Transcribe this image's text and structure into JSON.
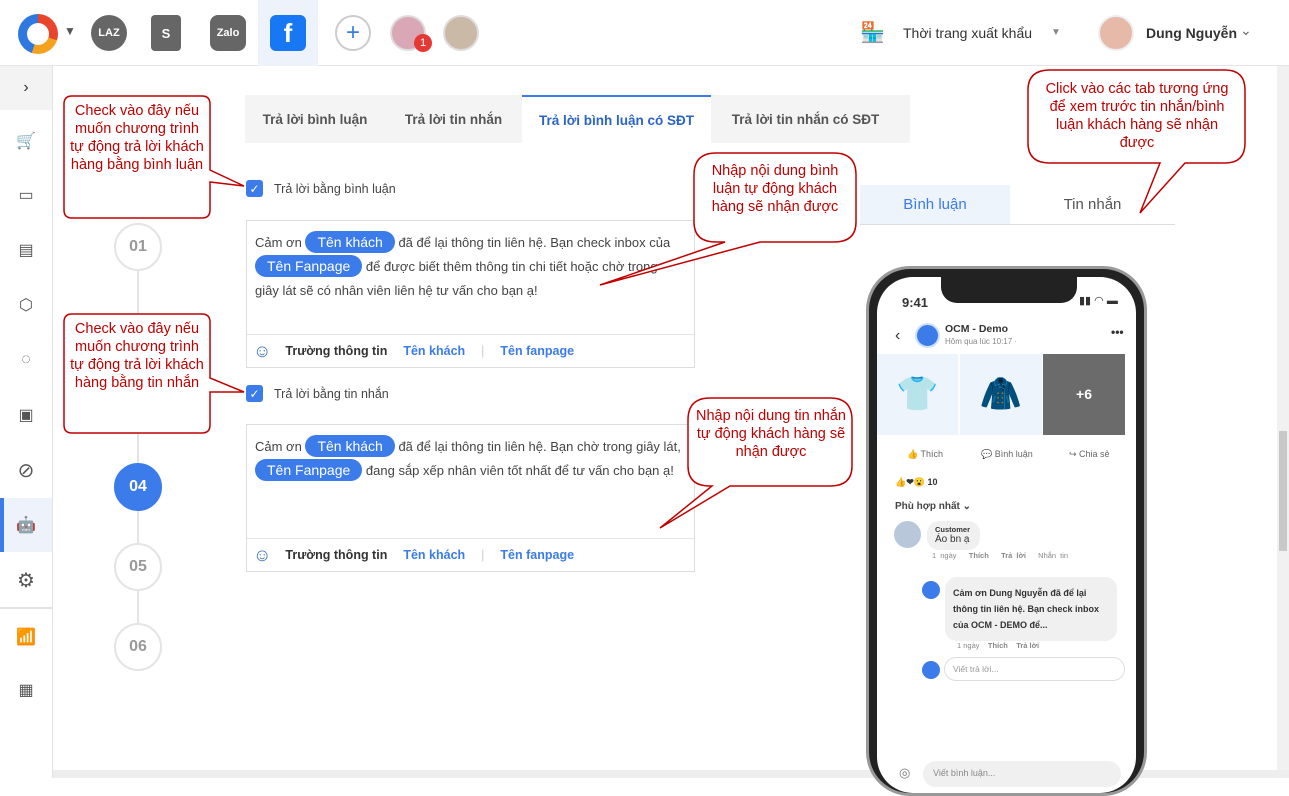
{
  "topbar": {
    "channels": [
      "LAZ",
      "S",
      "Zalo",
      "f"
    ],
    "notification_count": "1",
    "shop_name": "Thời trang xuất khẩu",
    "user_name": "Dung Nguyễn"
  },
  "tabs": [
    "Trả lời bình luận",
    "Trả lời tin nhắn",
    "Trả lời bình luận có SĐT",
    "Trả lời tin nhắn có SĐT"
  ],
  "steps": [
    "01",
    "04",
    "05",
    "06"
  ],
  "comment_reply": {
    "checkbox_label": "Trả lời bằng bình luận",
    "text_1": "Cảm ơn",
    "pill_1": "Tên khách",
    "text_2": "đã để lại thông tin liên hệ. Bạn check inbox của",
    "pill_2": "Tên Fanpage",
    "text_3": "để được biết thêm thông tin chi tiết hoặc chờ trong giây lát sẽ có nhân viên liên hệ tư vấn cho bạn ạ!"
  },
  "message_reply": {
    "checkbox_label": "Trả lời bằng tin nhắn",
    "text_1": "Cảm ơn",
    "pill_1": "Tên khách",
    "text_2": "đã để lại thông tin liên hệ. Bạn chờ trong giây lát,",
    "pill_2": "Tên Fanpage",
    "text_3": "đang sắp xếp nhân viên tốt nhất để tư vấn cho bạn ạ!"
  },
  "toolbar": {
    "field_label": "Trường thông tin",
    "guest": "Tên khách",
    "fanpage": "Tên fanpage"
  },
  "preview_tabs": [
    "Bình luận",
    "Tin nhắn"
  ],
  "phone": {
    "time": "9:41",
    "page_name": "OCM - Demo",
    "post_time": "Hôm qua lúc 10:17 ·",
    "more_photos": "+6",
    "actions": [
      "Thích",
      "Bình luận",
      "Chia sẻ"
    ],
    "reaction_count": "10",
    "sort": "Phù hợp nhất",
    "comment_author": "Customer",
    "comment_text": "Áo bn ạ",
    "comment_meta": [
      "1 ngày",
      "Thích",
      "Trả lời",
      "Nhắn tin"
    ],
    "reply_text": "Cảm ơn Dung Nguyễn đã để lại thông tin liên hệ. Bạn check inbox của OCM - DEMO để...",
    "reply_meta": [
      "1 ngày",
      "Thích",
      "Trả lời"
    ],
    "reply_placeholder": "Viết trả lời...",
    "comment_placeholder": "Viết bình luận..."
  },
  "callouts": [
    "Check vào đây nếu muốn chương trình tự động trả lời khách hàng bằng bình luận",
    "Check vào đây nếu muốn chương trình tự động trả lời khách hàng bằng tin nhắn",
    "Nhập nội dung bình luận tự động khách hàng sẽ nhận được",
    "Nhập nội dung tin nhắn tự động khách hàng sẽ nhận được",
    "Click vào các tab tương ứng để xem trước tin nhắn/bình luận khách hàng sẽ nhận được"
  ],
  "colors": {
    "accent": "#3b7bea",
    "callout": "#c00000"
  }
}
